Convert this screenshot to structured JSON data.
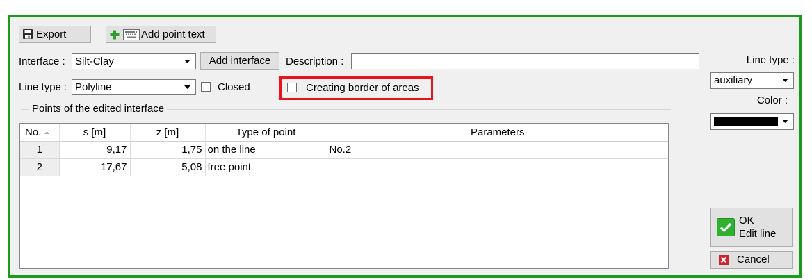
{
  "toolbar": {
    "export_label": "Export",
    "add_point_text_label": "Add point text"
  },
  "interface": {
    "label": "Interface :",
    "value": "Silt-Clay",
    "add_button_label": "Add interface",
    "description_label": "Description :",
    "description_value": ""
  },
  "line_type": {
    "label": "Line type :",
    "value": "Polyline",
    "closed_label": "Closed",
    "closed_checked": false,
    "border_of_areas_label": "Creating border of areas",
    "border_of_areas_checked": false
  },
  "points": {
    "group_title": "Points of the edited interface",
    "columns": [
      "No.",
      "s [m]",
      "z [m]",
      "Type of point",
      "Parameters"
    ],
    "rows": [
      {
        "no": "1",
        "s": "9,17",
        "z": "1,75",
        "type": "on the line",
        "parameters": "No.2"
      },
      {
        "no": "2",
        "s": "17,67",
        "z": "5,08",
        "type": "free point",
        "parameters": ""
      }
    ]
  },
  "side_panel": {
    "line_type_label": "Line type :",
    "line_type_value": "auxiliary",
    "color_label": "Color :",
    "color_value": "#000000",
    "ok_button": {
      "line1": "OK",
      "line2": "Edit line"
    },
    "cancel_label": "Cancel"
  },
  "colors": {
    "frame": "#1a9b1a",
    "highlight": "#e8141b"
  },
  "icons": {
    "export": "floppy-disk-icon",
    "add": "plus-icon",
    "point_text": "keyboard-icon",
    "dropdown": "chevron-down-icon",
    "sort": "sort-ascending-icon",
    "ok": "checkmark-icon",
    "cancel": "close-icon"
  }
}
